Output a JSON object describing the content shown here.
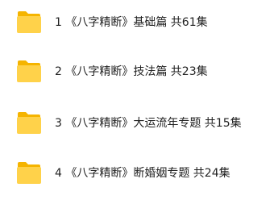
{
  "folders": [
    {
      "label": "1 《八字精断》基础篇 共61集",
      "icon": "folder-icon"
    },
    {
      "label": "2 《八字精断》技法篇 共23集",
      "icon": "folder-icon"
    },
    {
      "label": "3 《八字精断》大运流年专题 共15集",
      "icon": "folder-icon"
    },
    {
      "label": "4 《八字精断》断婚姻专题 共24集",
      "icon": "folder-icon"
    }
  ],
  "colors": {
    "folder_back": "#F5B400",
    "folder_front": "#FFD24A",
    "text": "#222222",
    "background": "#FFFFFF"
  }
}
